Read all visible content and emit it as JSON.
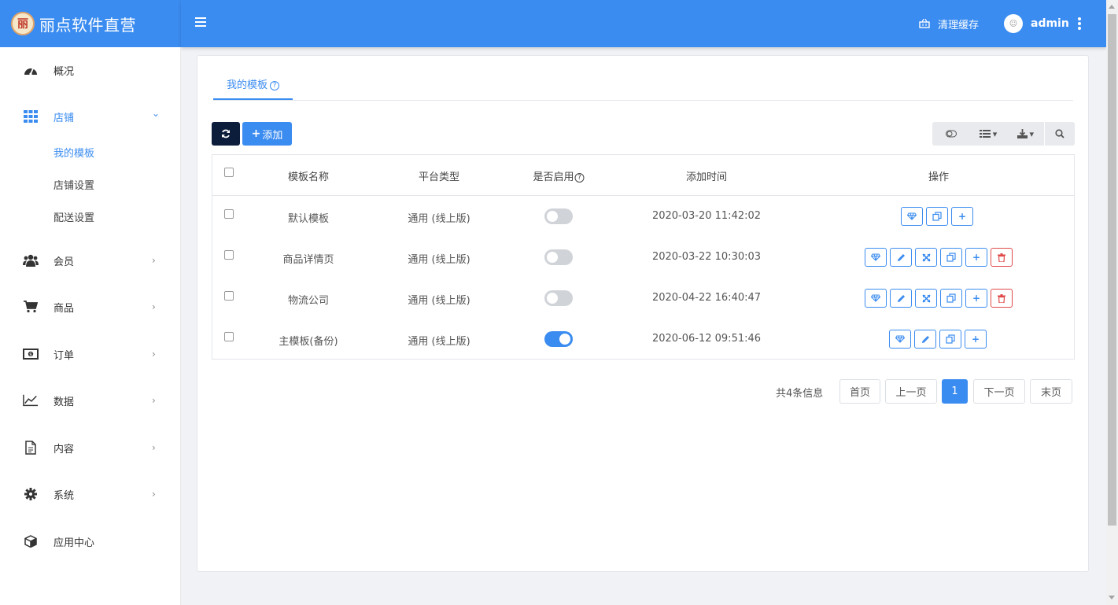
{
  "brand": {
    "title": "丽点软件直营",
    "logo_glyph": "丽"
  },
  "header": {
    "cache_label": "清理缓存",
    "user_name": "admin",
    "user_avatar_glyph": "☺",
    "accent_color": "#3b8cf0"
  },
  "sidebar": {
    "items": [
      {
        "label": "概况",
        "icon": "dashboard-icon"
      },
      {
        "label": "店铺",
        "icon": "grid-icon",
        "expanded": true
      },
      {
        "label": "会员",
        "icon": "users-icon"
      },
      {
        "label": "商品",
        "icon": "cart-icon"
      },
      {
        "label": "订单",
        "icon": "money-icon"
      },
      {
        "label": "数据",
        "icon": "chart-icon"
      },
      {
        "label": "内容",
        "icon": "document-icon"
      },
      {
        "label": "系统",
        "icon": "gear-icon"
      },
      {
        "label": "应用中心",
        "icon": "cube-icon"
      }
    ],
    "sub_items": [
      "我的模板",
      "店铺设置",
      "配送设置"
    ],
    "chevron_right": "›",
    "chevron_down": "⌄"
  },
  "main": {
    "tab_label": "我的模板",
    "tab_help": "?",
    "add_label": "添加",
    "table": {
      "headers": [
        "模板名称",
        "平台类型",
        "是否启用",
        "添加时间",
        "操作"
      ],
      "enabled_help": "?",
      "rows": [
        {
          "name": "默认模板",
          "platform": "通用 (线上版)",
          "enabled": false,
          "added": "2020-03-20 11:42:02",
          "actions": [
            "diamond-icon",
            "copy-icon",
            "plus-icon"
          ]
        },
        {
          "name": "商品详情页",
          "platform": "通用 (线上版)",
          "enabled": false,
          "added": "2020-03-22 10:30:03",
          "actions": [
            "diamond-icon",
            "pencil-icon",
            "expand-icon",
            "copy-icon",
            "plus-icon",
            "trash-icon"
          ]
        },
        {
          "name": "物流公司",
          "platform": "通用 (线上版)",
          "enabled": false,
          "added": "2020-04-22 16:40:47",
          "actions": [
            "diamond-icon",
            "pencil-icon",
            "expand-icon",
            "copy-icon",
            "plus-icon",
            "trash-icon"
          ]
        },
        {
          "name": "主模板(备份)",
          "platform": "通用 (线上版)",
          "enabled": true,
          "added": "2020-06-12 09:51:46",
          "actions": [
            "diamond-icon",
            "pencil-icon",
            "copy-icon",
            "plus-icon"
          ]
        }
      ]
    },
    "pagination": {
      "info": "共4条信息",
      "first": "首页",
      "prev": "上一页",
      "current": "1",
      "next": "下一页",
      "last": "末页"
    }
  }
}
